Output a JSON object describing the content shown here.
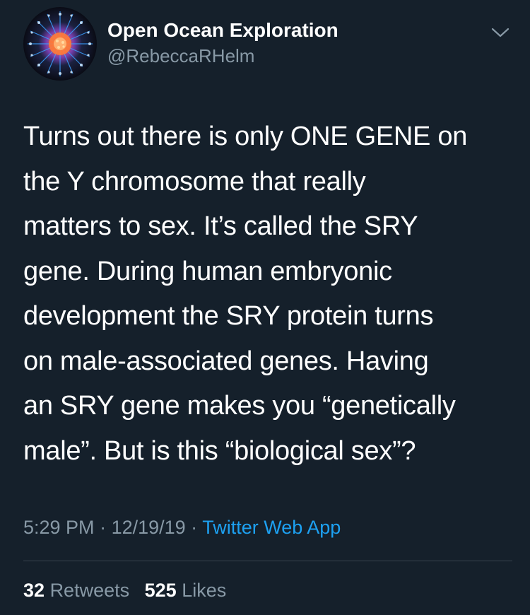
{
  "header": {
    "display_name": "Open Ocean Exploration",
    "handle": "@RebeccaRHelm",
    "avatar_icon": "siphonophore-avatar",
    "menu_icon": "chevron-down-icon"
  },
  "tweet": {
    "lines": [
      "Turns out there is only ONE GENE on",
      "the Y chromosome that really",
      "matters to sex. It’s called the SRY",
      "gene. During human embryonic",
      "development the SRY protein turns",
      "on male-associated genes. Having",
      "an SRY gene makes you “genetically",
      "male”. But is this “biological sex”?"
    ]
  },
  "meta": {
    "time": "5:29 PM",
    "separator": " · ",
    "date": "12/19/19",
    "source": "Twitter Web App"
  },
  "stats": {
    "retweets_count": "32",
    "retweets_label": "Retweets",
    "likes_count": "525",
    "likes_label": "Likes"
  },
  "colors": {
    "background": "#15202b",
    "text_primary": "#ffffff",
    "text_secondary": "#8899a6",
    "link": "#1da1f2",
    "divider": "#38444d"
  }
}
